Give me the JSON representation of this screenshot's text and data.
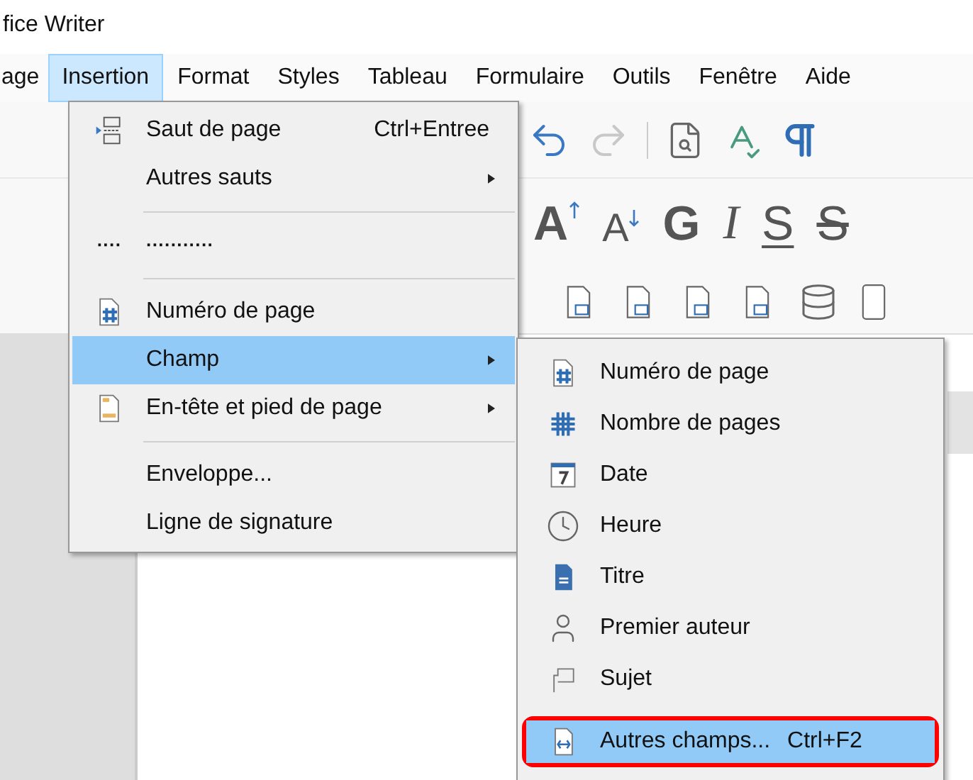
{
  "window": {
    "title": "fice Writer"
  },
  "menubar": [
    {
      "label": "age",
      "selected": false
    },
    {
      "label": "Insertion",
      "selected": true
    },
    {
      "label": "Format",
      "selected": false
    },
    {
      "label": "Styles",
      "selected": false
    },
    {
      "label": "Tableau",
      "selected": false
    },
    {
      "label": "Formulaire",
      "selected": false
    },
    {
      "label": "Outils",
      "selected": false
    },
    {
      "label": "Fenêtre",
      "selected": false
    },
    {
      "label": "Aide",
      "selected": false
    }
  ],
  "format_toolbar": [
    {
      "text": "A",
      "kind": "grow"
    },
    {
      "text": "A",
      "kind": "shrink"
    },
    {
      "text": "G",
      "kind": "bold"
    },
    {
      "text": "I",
      "kind": "italic"
    },
    {
      "text": "S",
      "kind": "underline"
    },
    {
      "text": "S",
      "kind": "strike"
    }
  ],
  "insert_menu": [
    {
      "kind": "item",
      "label": "Saut de page",
      "shortcut": "Ctrl+Entree",
      "submenu": false,
      "selected": false
    },
    {
      "kind": "item",
      "label": "Autres sauts",
      "submenu": true,
      "selected": false
    },
    {
      "kind": "separator"
    },
    {
      "kind": "item",
      "glyph": "····",
      "label": "···········",
      "submenu": false,
      "selected": false
    },
    {
      "kind": "separator"
    },
    {
      "kind": "item",
      "label": "Numéro de page",
      "submenu": false,
      "selected": false
    },
    {
      "kind": "item",
      "label": "Champ",
      "submenu": true,
      "selected": true
    },
    {
      "kind": "item",
      "label": "En-tête et pied de page",
      "submenu": true,
      "selected": false
    },
    {
      "kind": "separator"
    },
    {
      "kind": "item",
      "label": "Enveloppe...",
      "submenu": false,
      "selected": false
    },
    {
      "kind": "item",
      "label": "Ligne de signature",
      "submenu": false,
      "selected": false
    }
  ],
  "field_submenu": [
    {
      "label": "Numéro de page",
      "selected": false,
      "outlined": false
    },
    {
      "label": "Nombre de pages",
      "selected": false,
      "outlined": false
    },
    {
      "label": "Date",
      "selected": false,
      "outlined": false
    },
    {
      "label": "Heure",
      "selected": false,
      "outlined": false
    },
    {
      "label": "Titre",
      "selected": false,
      "outlined": false
    },
    {
      "label": "Premier auteur",
      "selected": false,
      "outlined": false
    },
    {
      "label": "Sujet",
      "selected": false,
      "outlined": false
    },
    {
      "label": "Autres champs...",
      "shortcut": "Ctrl+F2",
      "selected": true,
      "outlined": true
    }
  ]
}
